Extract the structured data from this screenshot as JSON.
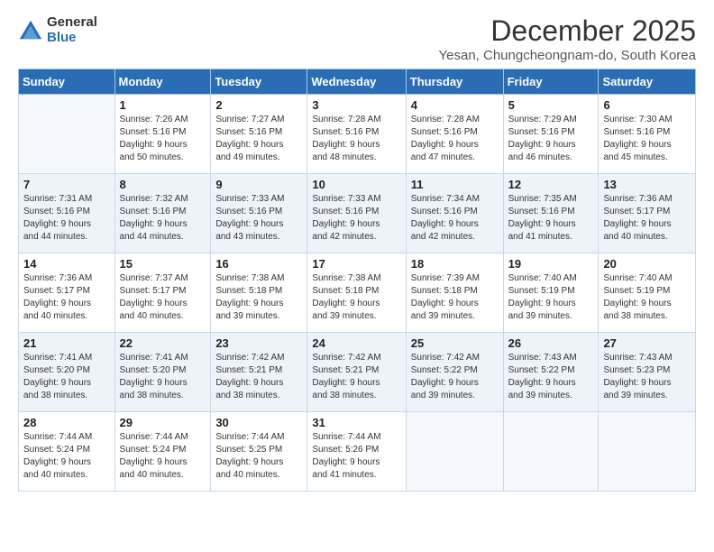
{
  "logo": {
    "line1": "General",
    "line2": "Blue"
  },
  "title": "December 2025",
  "subtitle": "Yesan, Chungcheongnam-do, South Korea",
  "weekdays": [
    "Sunday",
    "Monday",
    "Tuesday",
    "Wednesday",
    "Thursday",
    "Friday",
    "Saturday"
  ],
  "weeks": [
    [
      {
        "day": "",
        "info": ""
      },
      {
        "day": "1",
        "info": "Sunrise: 7:26 AM\nSunset: 5:16 PM\nDaylight: 9 hours\nand 50 minutes."
      },
      {
        "day": "2",
        "info": "Sunrise: 7:27 AM\nSunset: 5:16 PM\nDaylight: 9 hours\nand 49 minutes."
      },
      {
        "day": "3",
        "info": "Sunrise: 7:28 AM\nSunset: 5:16 PM\nDaylight: 9 hours\nand 48 minutes."
      },
      {
        "day": "4",
        "info": "Sunrise: 7:28 AM\nSunset: 5:16 PM\nDaylight: 9 hours\nand 47 minutes."
      },
      {
        "day": "5",
        "info": "Sunrise: 7:29 AM\nSunset: 5:16 PM\nDaylight: 9 hours\nand 46 minutes."
      },
      {
        "day": "6",
        "info": "Sunrise: 7:30 AM\nSunset: 5:16 PM\nDaylight: 9 hours\nand 45 minutes."
      }
    ],
    [
      {
        "day": "7",
        "info": "Sunrise: 7:31 AM\nSunset: 5:16 PM\nDaylight: 9 hours\nand 44 minutes."
      },
      {
        "day": "8",
        "info": "Sunrise: 7:32 AM\nSunset: 5:16 PM\nDaylight: 9 hours\nand 44 minutes."
      },
      {
        "day": "9",
        "info": "Sunrise: 7:33 AM\nSunset: 5:16 PM\nDaylight: 9 hours\nand 43 minutes."
      },
      {
        "day": "10",
        "info": "Sunrise: 7:33 AM\nSunset: 5:16 PM\nDaylight: 9 hours\nand 42 minutes."
      },
      {
        "day": "11",
        "info": "Sunrise: 7:34 AM\nSunset: 5:16 PM\nDaylight: 9 hours\nand 42 minutes."
      },
      {
        "day": "12",
        "info": "Sunrise: 7:35 AM\nSunset: 5:16 PM\nDaylight: 9 hours\nand 41 minutes."
      },
      {
        "day": "13",
        "info": "Sunrise: 7:36 AM\nSunset: 5:17 PM\nDaylight: 9 hours\nand 40 minutes."
      }
    ],
    [
      {
        "day": "14",
        "info": "Sunrise: 7:36 AM\nSunset: 5:17 PM\nDaylight: 9 hours\nand 40 minutes."
      },
      {
        "day": "15",
        "info": "Sunrise: 7:37 AM\nSunset: 5:17 PM\nDaylight: 9 hours\nand 40 minutes."
      },
      {
        "day": "16",
        "info": "Sunrise: 7:38 AM\nSunset: 5:18 PM\nDaylight: 9 hours\nand 39 minutes."
      },
      {
        "day": "17",
        "info": "Sunrise: 7:38 AM\nSunset: 5:18 PM\nDaylight: 9 hours\nand 39 minutes."
      },
      {
        "day": "18",
        "info": "Sunrise: 7:39 AM\nSunset: 5:18 PM\nDaylight: 9 hours\nand 39 minutes."
      },
      {
        "day": "19",
        "info": "Sunrise: 7:40 AM\nSunset: 5:19 PM\nDaylight: 9 hours\nand 39 minutes."
      },
      {
        "day": "20",
        "info": "Sunrise: 7:40 AM\nSunset: 5:19 PM\nDaylight: 9 hours\nand 38 minutes."
      }
    ],
    [
      {
        "day": "21",
        "info": "Sunrise: 7:41 AM\nSunset: 5:20 PM\nDaylight: 9 hours\nand 38 minutes."
      },
      {
        "day": "22",
        "info": "Sunrise: 7:41 AM\nSunset: 5:20 PM\nDaylight: 9 hours\nand 38 minutes."
      },
      {
        "day": "23",
        "info": "Sunrise: 7:42 AM\nSunset: 5:21 PM\nDaylight: 9 hours\nand 38 minutes."
      },
      {
        "day": "24",
        "info": "Sunrise: 7:42 AM\nSunset: 5:21 PM\nDaylight: 9 hours\nand 38 minutes."
      },
      {
        "day": "25",
        "info": "Sunrise: 7:42 AM\nSunset: 5:22 PM\nDaylight: 9 hours\nand 39 minutes."
      },
      {
        "day": "26",
        "info": "Sunrise: 7:43 AM\nSunset: 5:22 PM\nDaylight: 9 hours\nand 39 minutes."
      },
      {
        "day": "27",
        "info": "Sunrise: 7:43 AM\nSunset: 5:23 PM\nDaylight: 9 hours\nand 39 minutes."
      }
    ],
    [
      {
        "day": "28",
        "info": "Sunrise: 7:44 AM\nSunset: 5:24 PM\nDaylight: 9 hours\nand 40 minutes."
      },
      {
        "day": "29",
        "info": "Sunrise: 7:44 AM\nSunset: 5:24 PM\nDaylight: 9 hours\nand 40 minutes."
      },
      {
        "day": "30",
        "info": "Sunrise: 7:44 AM\nSunset: 5:25 PM\nDaylight: 9 hours\nand 40 minutes."
      },
      {
        "day": "31",
        "info": "Sunrise: 7:44 AM\nSunset: 5:26 PM\nDaylight: 9 hours\nand 41 minutes."
      },
      {
        "day": "",
        "info": ""
      },
      {
        "day": "",
        "info": ""
      },
      {
        "day": "",
        "info": ""
      }
    ]
  ]
}
